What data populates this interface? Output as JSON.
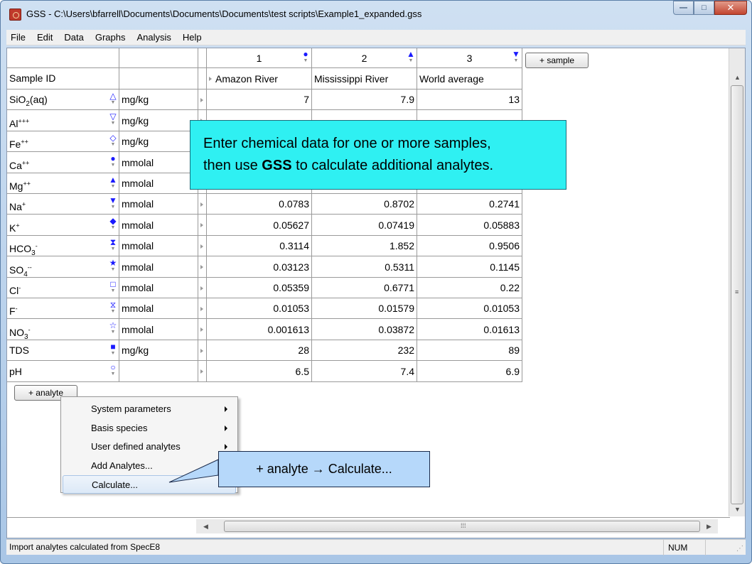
{
  "window": {
    "title": "GSS - C:\\Users\\bfarrell\\Documents\\Documents\\Documents\\test scripts\\Example1_expanded.gss",
    "min_label": "—",
    "max_label": "□",
    "close_label": "✕"
  },
  "menu": [
    "File",
    "Edit",
    "Data",
    "Graphs",
    "Analysis",
    "Help"
  ],
  "grid": {
    "sample_id_header": "Sample ID",
    "samples": [
      {
        "number": "1",
        "name": "Amazon River",
        "symbol": "●",
        "symbol_name": "circle-filled-icon"
      },
      {
        "number": "2",
        "name": "Mississippi River",
        "symbol": "▲",
        "symbol_name": "triangle-filled-icon"
      },
      {
        "number": "3",
        "name": "World average",
        "symbol": "▼",
        "symbol_name": "triangle-down-filled-icon"
      }
    ],
    "add_sample_label": "+ sample",
    "rows": [
      {
        "id": "SiO",
        "sub": "2",
        "sup": "",
        "tail": "(aq)",
        "symbol": "△",
        "units": "mg/kg",
        "values": [
          "7",
          "7.9",
          "13"
        ]
      },
      {
        "id": "Al",
        "sub": "",
        "sup": "+++",
        "tail": "",
        "symbol": "▽",
        "units": "mg/kg",
        "values": [
          "",
          "",
          ""
        ]
      },
      {
        "id": "Fe",
        "sub": "",
        "sup": "++",
        "tail": "",
        "symbol": "◇",
        "units": "mg/kg",
        "values": [
          "",
          "",
          ""
        ]
      },
      {
        "id": "Ca",
        "sub": "",
        "sup": "++",
        "tail": "",
        "symbol": "●",
        "units": "mmolal",
        "values": [
          "",
          "",
          ""
        ]
      },
      {
        "id": "Mg",
        "sub": "",
        "sup": "++",
        "tail": "",
        "symbol": "▲",
        "units": "mmolal",
        "values": [
          "",
          "",
          ""
        ]
      },
      {
        "id": "Na",
        "sub": "",
        "sup": "+",
        "tail": "",
        "symbol": "▼",
        "units": "mmolal",
        "values": [
          "0.0783",
          "0.8702",
          "0.2741"
        ]
      },
      {
        "id": "K",
        "sub": "",
        "sup": "+",
        "tail": "",
        "symbol": "◆",
        "units": "mmolal",
        "values": [
          "0.05627",
          "0.07419",
          "0.05883"
        ]
      },
      {
        "id": "HCO",
        "sub": "3",
        "sup": "-",
        "tail": "",
        "symbol": "⧗",
        "units": "mmolal",
        "values": [
          "0.3114",
          "1.852",
          "0.9506"
        ]
      },
      {
        "id": "SO",
        "sub": "4",
        "sup": "--",
        "tail": "",
        "symbol": "★",
        "units": "mmolal",
        "values": [
          "0.03123",
          "0.5311",
          "0.1145"
        ]
      },
      {
        "id": "Cl",
        "sub": "",
        "sup": "-",
        "tail": "",
        "symbol": "□",
        "units": "mmolal",
        "values": [
          "0.05359",
          "0.6771",
          "0.22"
        ]
      },
      {
        "id": "F",
        "sub": "",
        "sup": "-",
        "tail": "",
        "symbol": "⧖",
        "units": "mmolal",
        "values": [
          "0.01053",
          "0.01579",
          "0.01053"
        ]
      },
      {
        "id": "NO",
        "sub": "3",
        "sup": "-",
        "tail": "",
        "symbol": "☆",
        "units": "mmolal",
        "values": [
          "0.001613",
          "0.03872",
          "0.01613"
        ]
      },
      {
        "id": "TDS",
        "sub": "",
        "sup": "",
        "tail": "",
        "symbol": "■",
        "units": "mg/kg",
        "values": [
          "28",
          "232",
          "89"
        ]
      },
      {
        "id": "pH",
        "sub": "",
        "sup": "",
        "tail": "",
        "symbol": "○",
        "units": "",
        "values": [
          "6.5",
          "7.4",
          "6.9"
        ]
      }
    ],
    "add_analyte_label": "+ analyte"
  },
  "context_menu": [
    {
      "label": "System parameters",
      "submenu": true
    },
    {
      "label": "Basis species",
      "submenu": true
    },
    {
      "label": "User defined analytes",
      "submenu": true
    },
    {
      "label": "Add Analytes...",
      "submenu": false
    },
    {
      "label": "Calculate...",
      "submenu": false,
      "highlighted": true
    }
  ],
  "callouts": {
    "main_line1": "Enter chemical data for one or more samples,",
    "main_line2_pre": "then use ",
    "main_line2_bold": "GSS",
    "main_line2_post": " to calculate additional analytes.",
    "secondary": "+ analyte → Calculate..."
  },
  "status": {
    "text": "Import analytes calculated from SpecE8",
    "num": "NUM"
  },
  "colors": {
    "symbol": "#1a1aff",
    "callout_main": "#2ff0f2",
    "callout_secondary": "#b6d8fa"
  }
}
